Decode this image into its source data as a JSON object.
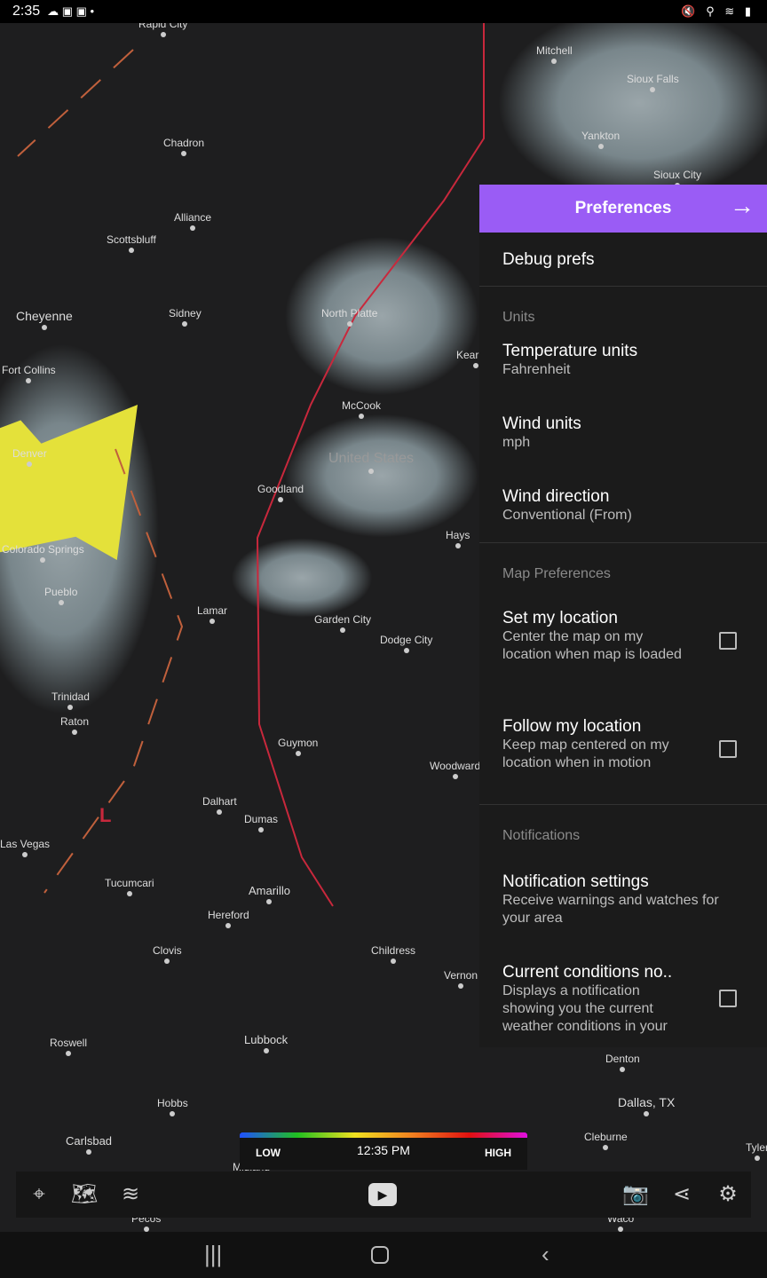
{
  "status_bar": {
    "time": "2:35",
    "icons": "☁ ▣ ▣ •",
    "right_icons": "🔇 ⚲ ≋ ▮"
  },
  "map": {
    "cities": [
      "Rapid City",
      "Chadron",
      "Alliance",
      "Scottsbluff",
      "Sidney",
      "Cheyenne",
      "Fort Collins",
      "Denver",
      "Colorado Springs",
      "Pueblo",
      "Trinidad",
      "Raton",
      "Las Vegas",
      "Goodland",
      "McCook",
      "United States",
      "Hays",
      "Lamar",
      "Garden City",
      "Dodge City",
      "Guymon",
      "Woodward",
      "Dalhart",
      "Dumas",
      "Tucumcari",
      "Amarillo",
      "Hereford",
      "Clovis",
      "Childress",
      "Vernon",
      "Roswell",
      "Lubbock",
      "Hobbs",
      "Carlsbad",
      "Midland",
      "Pecos",
      "Denton",
      "Dallas, TX",
      "Cleburne",
      "Waco",
      "Mitchell",
      "Sioux Falls",
      "Yankton",
      "Sioux City",
      "Kearney",
      "North Platte",
      "Tyler"
    ],
    "front_label": "L"
  },
  "preferences": {
    "header": "Preferences",
    "debug": "Debug prefs",
    "units_section": "Units",
    "temperature": {
      "title": "Temperature units",
      "value": "Fahrenheit"
    },
    "wind": {
      "title": "Wind units",
      "value": "mph"
    },
    "wind_direction": {
      "title": "Wind direction",
      "value": "Conventional (From)"
    },
    "map_section": "Map Preferences",
    "set_location": {
      "title": "Set my location",
      "desc": "Center the map on my location when map is loaded",
      "checked": false
    },
    "follow_location": {
      "title": "Follow my location",
      "desc": "Keep map centered on my location when in motion",
      "checked": false
    },
    "notif_section": "Notifications",
    "notif_settings": {
      "title": "Notification settings",
      "desc": "Receive warnings and watches for your area"
    },
    "current_conditions": {
      "title": "Current conditions no..",
      "desc": "Displays a notification showing you the current weather conditions in your",
      "checked": false
    }
  },
  "legend": {
    "low": "LOW",
    "time": "12:35 PM",
    "high": "HIGH"
  },
  "accent": "#9a5cf5"
}
